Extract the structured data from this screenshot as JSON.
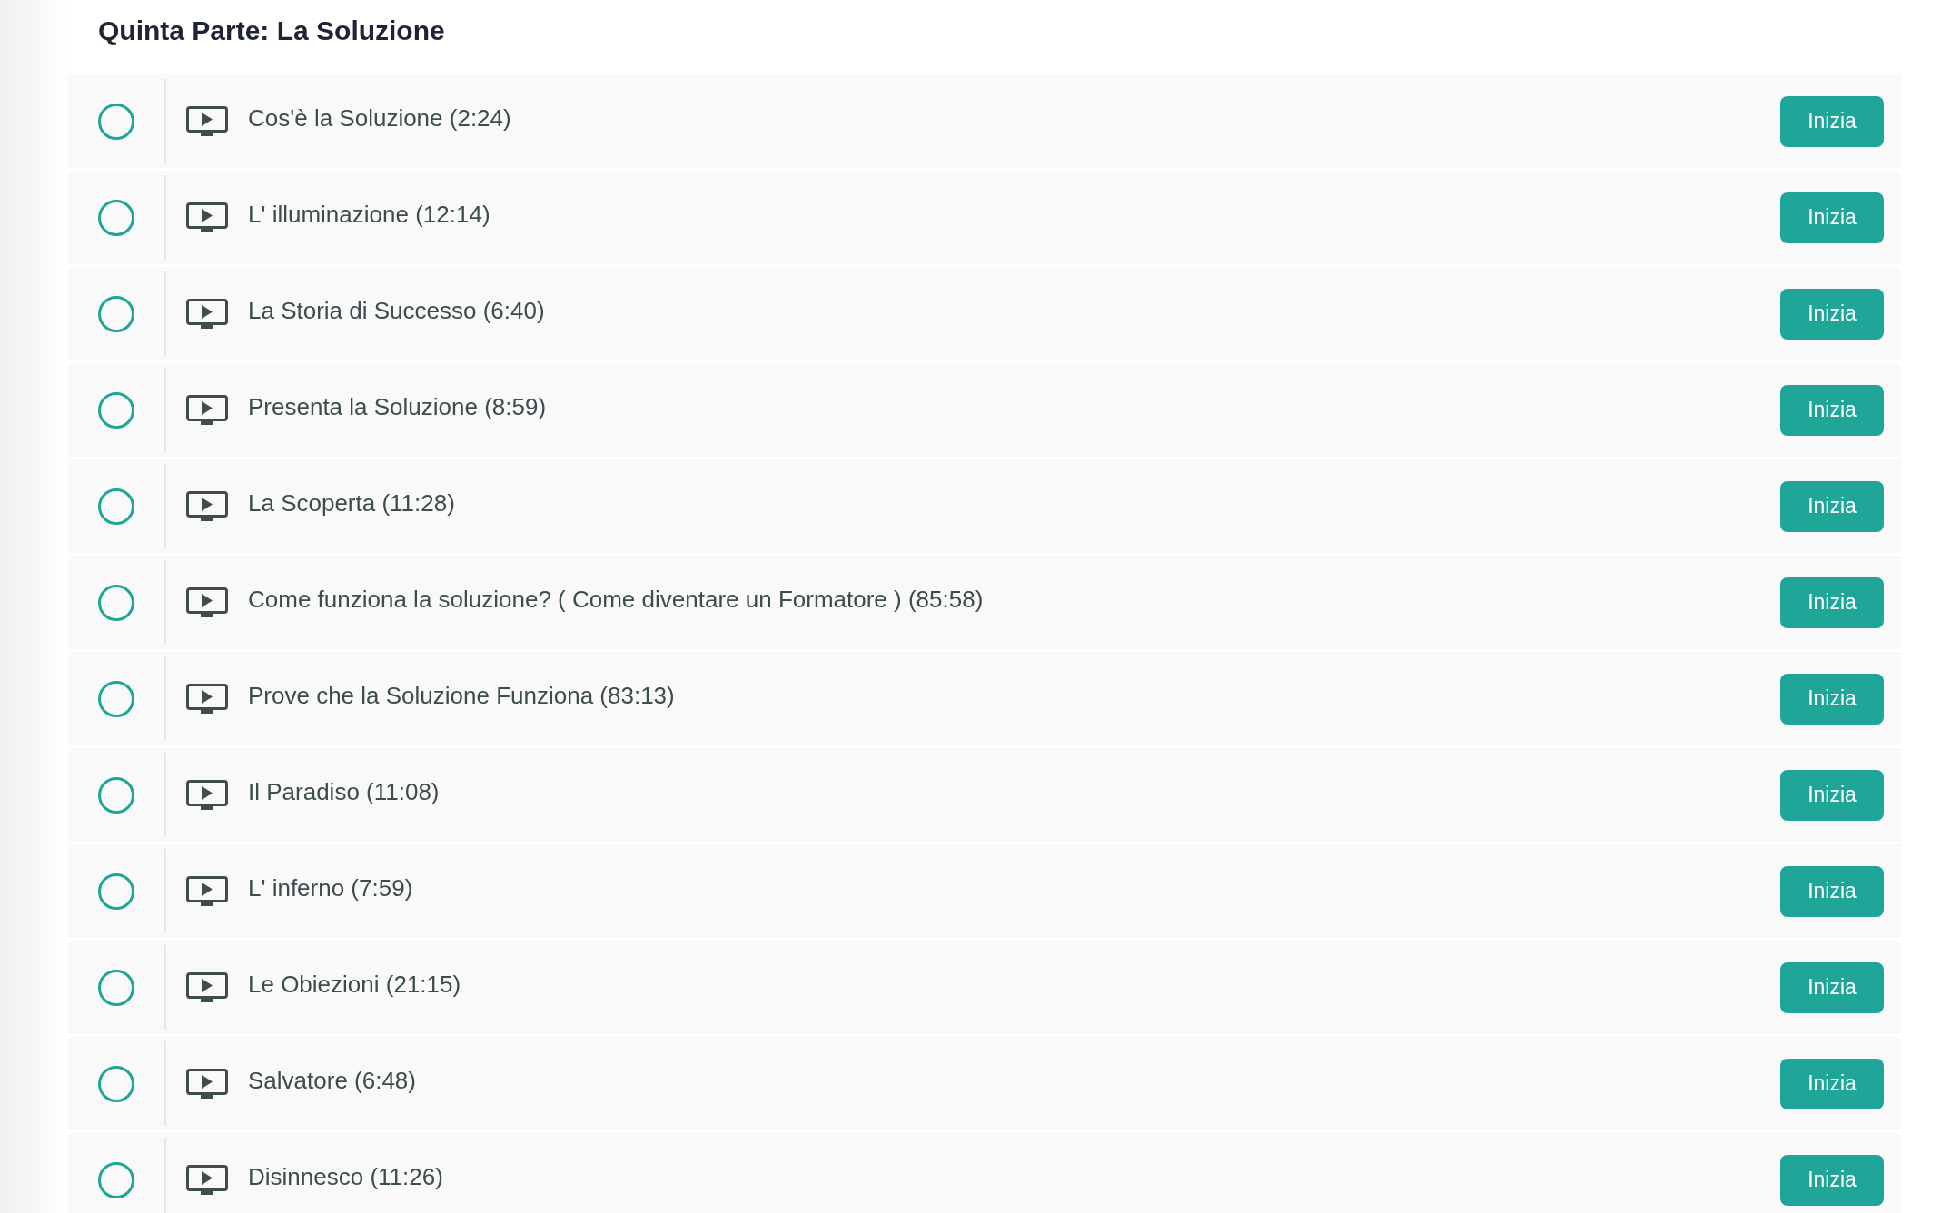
{
  "section": {
    "title": "Quinta Parte: La Soluzione"
  },
  "lessons": [
    {
      "title": "Cos'è la Soluzione (2:24)",
      "completed": false,
      "button": "Inizia"
    },
    {
      "title": "L' illuminazione (12:14)",
      "completed": false,
      "button": "Inizia"
    },
    {
      "title": "La Storia di Successo (6:40)",
      "completed": false,
      "button": "Inizia"
    },
    {
      "title": "Presenta la Soluzione (8:59)",
      "completed": false,
      "button": "Inizia"
    },
    {
      "title": "La Scoperta (11:28)",
      "completed": false,
      "button": "Inizia"
    },
    {
      "title": "Come funziona la soluzione? ( Come diventare un Formatore ) (85:58)",
      "completed": false,
      "button": "Inizia"
    },
    {
      "title": "Prove che la Soluzione Funziona (83:13)",
      "completed": false,
      "button": "Inizia"
    },
    {
      "title": "Il Paradiso (11:08)",
      "completed": false,
      "button": "Inizia"
    },
    {
      "title": "L' inferno (7:59)",
      "completed": false,
      "button": "Inizia"
    },
    {
      "title": "Le Obiezioni (21:15)",
      "completed": false,
      "button": "Inizia"
    },
    {
      "title": "Salvatore (6:48)",
      "completed": false,
      "button": "Inizia"
    },
    {
      "title": "Disinnesco (11:26)",
      "completed": false,
      "button": "Inizia"
    }
  ]
}
